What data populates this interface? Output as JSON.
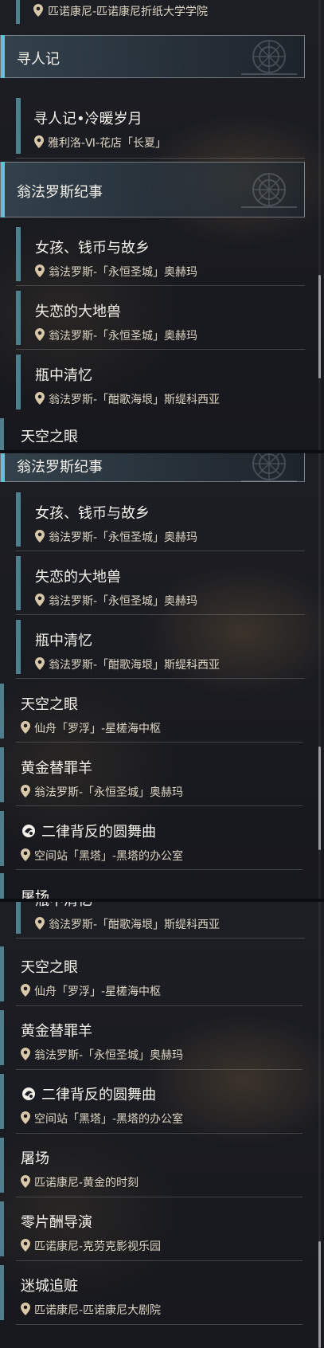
{
  "colors": {
    "accent": "#5fc3d6",
    "bar": "#4f7f8c",
    "pin": "#d8c8a8",
    "location_text": "#ded6c4"
  },
  "icons": {
    "location": "location-pin-icon",
    "special_quest": "special-quest-icon",
    "crest": "faction-crest-icon"
  },
  "panel1": {
    "top_location": "匹诺康尼-匹诺康尼折纸大学学院",
    "header1": "寻人记",
    "quest1": {
      "title": "寻人记•冷暖岁月",
      "location": "雅利洛-Ⅵ-花店「长夏」"
    },
    "header2": "翁法罗斯纪事",
    "quests": [
      {
        "title": "女孩、钱币与故乡",
        "location": "翁法罗斯-「永恒圣城」奥赫玛"
      },
      {
        "title": "失恋的大地兽",
        "location": "翁法罗斯-「永恒圣城」奥赫玛"
      },
      {
        "title": "瓶中清忆",
        "location": "翁法罗斯-「酣歌海垠」斯缇科西亚"
      }
    ],
    "cut_bottom": "天空之眼"
  },
  "panel2": {
    "header": "翁法罗斯纪事",
    "sub_quests": [
      {
        "title": "女孩、钱币与故乡",
        "location": "翁法罗斯-「永恒圣城」奥赫玛"
      },
      {
        "title": "失恋的大地兽",
        "location": "翁法罗斯-「永恒圣城」奥赫玛"
      },
      {
        "title": "瓶中清忆",
        "location": "翁法罗斯-「酣歌海垠」斯缇科西亚"
      }
    ],
    "quests": [
      {
        "title": "天空之眼",
        "location": "仙舟「罗浮」-星槎海中枢"
      },
      {
        "title": "黄金替罪羊",
        "location": "翁法罗斯-「永恒圣城」奥赫玛"
      },
      {
        "title": "二律背反的圆舞曲",
        "location": "空间站「黑塔」-黑塔的办公室"
      }
    ],
    "cut_bottom": "屠场"
  },
  "panel3": {
    "cut_top": {
      "title": "瓶中清忆",
      "location": "翁法罗斯-「酣歌海垠」斯缇科西亚"
    },
    "quests": [
      {
        "title": "天空之眼",
        "location": "仙舟「罗浮」-星槎海中枢"
      },
      {
        "title": "黄金替罪羊",
        "location": "翁法罗斯-「永恒圣城」奥赫玛"
      },
      {
        "title": "二律背反的圆舞曲",
        "location": "空间站「黑塔」-黑塔的办公室"
      },
      {
        "title": "屠场",
        "location": "匹诺康尼-黄金的时刻"
      },
      {
        "title": "零片酬导演",
        "location": "匹诺康尼-克劳克影视乐园"
      },
      {
        "title": "迷城追赃",
        "location": "匹诺康尼-匹诺康尼大剧院"
      }
    ]
  }
}
